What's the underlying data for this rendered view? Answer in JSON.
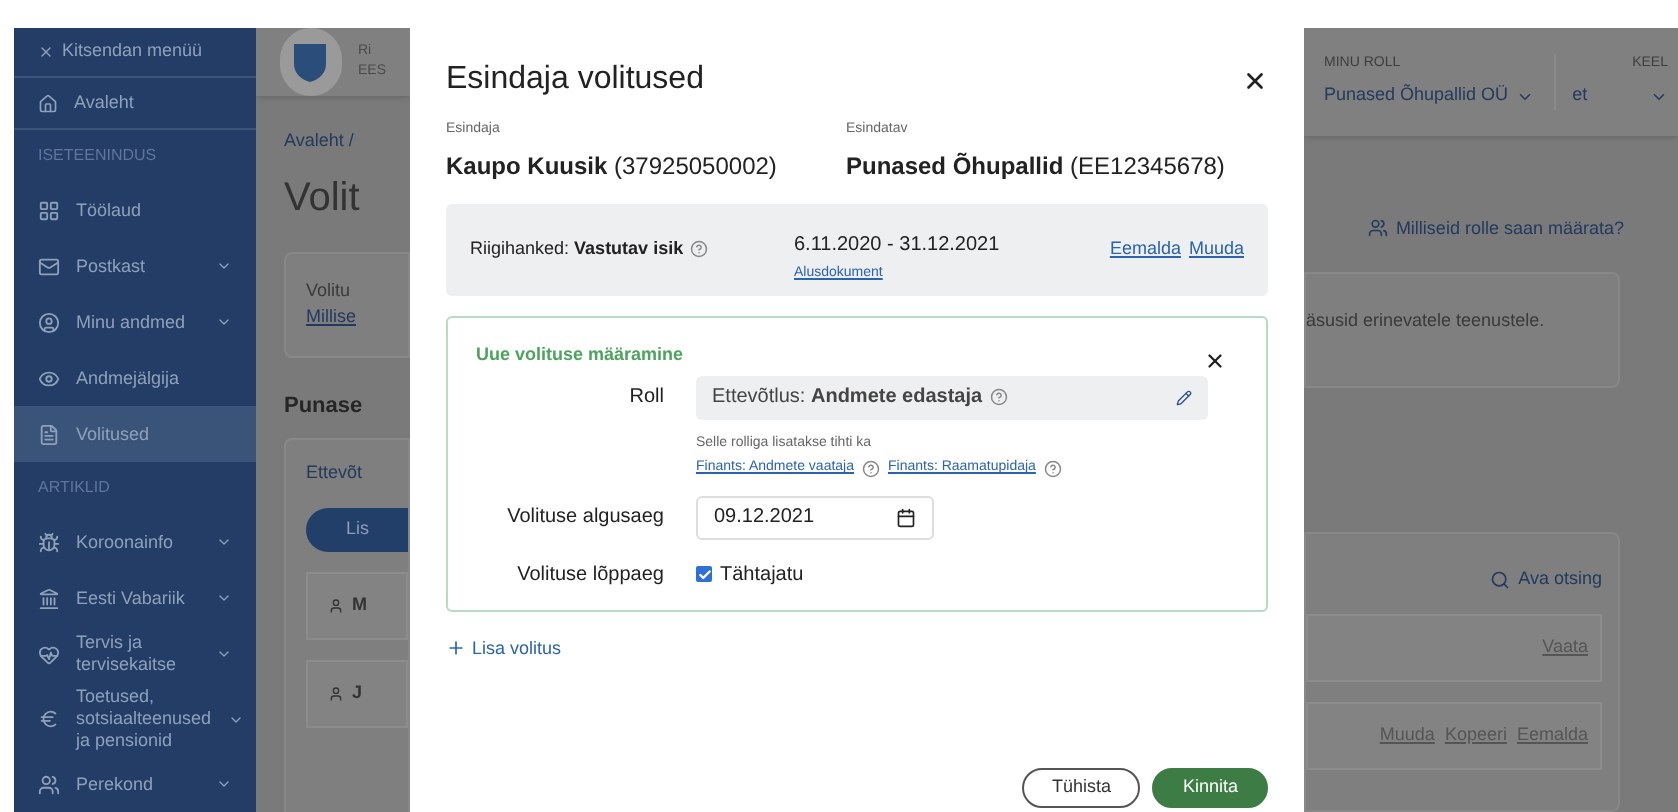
{
  "sidebar": {
    "collapse": "Kitsendan menüü",
    "home": "Avaleht",
    "sections": [
      {
        "title": "ISETEENINDUS",
        "items": [
          {
            "label": "Töölaud",
            "expandable": false,
            "selected": false
          },
          {
            "label": "Postkast",
            "expandable": true,
            "selected": false
          },
          {
            "label": "Minu andmed",
            "expandable": true,
            "selected": false
          },
          {
            "label": "Andmejälgija",
            "expandable": false,
            "selected": false
          },
          {
            "label": "Volitused",
            "expandable": false,
            "selected": true
          }
        ]
      },
      {
        "title": "ARTIKLID",
        "items": [
          {
            "label": "Koroonainfo",
            "expandable": true,
            "selected": false
          },
          {
            "label": "Eesti Vabariik",
            "expandable": true,
            "selected": false
          },
          {
            "label": "Tervis ja tervisekaitse",
            "expandable": true,
            "selected": false
          },
          {
            "label": "Toetused, sotsiaalteenused ja pensionid",
            "expandable": true,
            "selected": false
          },
          {
            "label": "Perekond",
            "expandable": true,
            "selected": false
          }
        ]
      }
    ]
  },
  "header": {
    "logo_text": [
      "Ri",
      "EES"
    ],
    "role_label": "MINU ROLL",
    "role_value": "Punased Õhupallid OÜ",
    "language_label": "KEEL",
    "language_value": "et"
  },
  "page": {
    "breadcrumb": "Avaleht /",
    "heading": "Volit",
    "info_lines": [
      "Volitu",
      "Millise"
    ],
    "info_right": "äsusid erinevatele teenustele.",
    "help_link": "Milliseid rolle saan määrata?",
    "section_heading": "Punase",
    "tab": "Ettevõt",
    "add_button": "Lis",
    "search": "Ava otsing",
    "rows": [
      {
        "name": "M",
        "actions": [
          "Vaata"
        ]
      },
      {
        "name": "J",
        "actions": [
          "Muuda",
          "Kopeeri",
          "Eemalda"
        ]
      }
    ]
  },
  "modal": {
    "title": "Esindaja volitused",
    "parties": [
      {
        "label": "Esindaja",
        "name": "Kaupo Kuusik",
        "code": "(37925050002)"
      },
      {
        "label": "Esindatav",
        "name": "Punased Õhupallid",
        "code": "(EE12345678)"
      }
    ],
    "existing": {
      "area": "Riigihanked:",
      "role": "Vastutav isik",
      "period": "6.11.2020 - 31.12.2021",
      "document_link": "Alusdokument",
      "actions": [
        "Eemalda",
        "Muuda"
      ]
    },
    "new_mandate": {
      "title": "Uue volituse määramine",
      "role_label": "Roll",
      "role_area": "Ettevõtlus:",
      "role_name": "Andmete edastaja",
      "note": "Selle rolliga lisatakse tihti ka",
      "related_roles": [
        "Finants: Andmete vaataja",
        "Finants: Raamatupidaja"
      ],
      "start_label": "Volituse algusaeg",
      "start_value": "09.12.2021",
      "end_label": "Volituse lõppaeg",
      "indefinite": {
        "label": "Tähtajatu",
        "checked": true
      }
    },
    "add_link": "Lisa volitus",
    "buttons": [
      {
        "label": "Tühista",
        "kind": "secondary"
      },
      {
        "label": "Kinnita",
        "kind": "primary"
      }
    ]
  }
}
